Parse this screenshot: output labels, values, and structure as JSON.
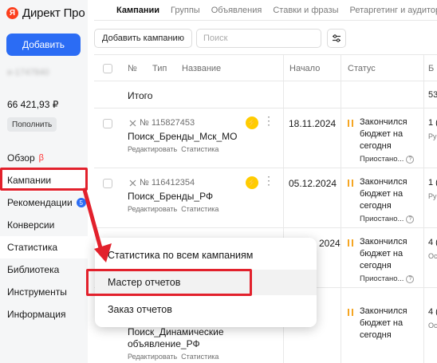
{
  "app": {
    "logo_letter": "Я",
    "title": "Директ Про"
  },
  "sidebar": {
    "add_button": "Добавить",
    "login": "e-1747840",
    "balance": "66 421,93 ₽",
    "topup_button": "Пополнить",
    "items": [
      {
        "label": "Обзор",
        "suffix": "β"
      },
      {
        "label": "Кампании"
      },
      {
        "label": "Рекомендации",
        "badge": "5"
      },
      {
        "label": "Конверсии"
      },
      {
        "label": "Статистика"
      },
      {
        "label": "Библиотека"
      },
      {
        "label": "Инструменты"
      },
      {
        "label": "Информация"
      }
    ]
  },
  "tabs": [
    "Кампании",
    "Группы",
    "Объявления",
    "Ставки и фразы",
    "Ретаргетинг и аудитории"
  ],
  "toolbar": {
    "add_campaign": "Добавить кампанию",
    "search_placeholder": "Поиск"
  },
  "table": {
    "headers": {
      "num": "№",
      "type": "Тип",
      "name": "Название",
      "start": "Начало",
      "status": "Статус",
      "last": "Б"
    },
    "total_label": "Итого",
    "total_last": "53",
    "rows": [
      {
        "id": "№ 115827453",
        "name": "Поиск_Бренды_Мск_МО",
        "links": [
          "Редактировать",
          "Статистика"
        ],
        "start": "18.11.2024",
        "status": "Закончился бюджет на сегодня",
        "status_sub": "Приостано...",
        "last": "1 (",
        "last_sub": "Ру"
      },
      {
        "id": "№ 116412354",
        "name": "Поиск_Бренды_РФ",
        "links": [
          "Редактировать",
          "Статистика"
        ],
        "start": "05.12.2024",
        "status": "Закончился бюджет на сегодня",
        "status_sub": "Приостано...",
        "last": "1 (",
        "last_sub": "Ру"
      },
      {
        "start": "2024",
        "status": "Закончился бюджет на сегодня",
        "status_sub": "Приостано...",
        "last": "4 (",
        "last_sub": "Ос"
      },
      {
        "name_line1": "Поиск_Динамические",
        "name_line2": "объявление_РФ",
        "links": [
          "Редактировать",
          "Статистика"
        ],
        "status": "Закончился бюджет на сегодня",
        "last": "4 (",
        "last_sub": "Ос"
      }
    ]
  },
  "dropdown": {
    "items": [
      "Статистика по всем кампаниям",
      "Мастер отчетов",
      "Заказ отчетов"
    ]
  },
  "colors": {
    "accent": "#2b6cf4",
    "highlight": "#e2212c",
    "paused": "#f5a623",
    "bolt": "#ffcc00"
  }
}
